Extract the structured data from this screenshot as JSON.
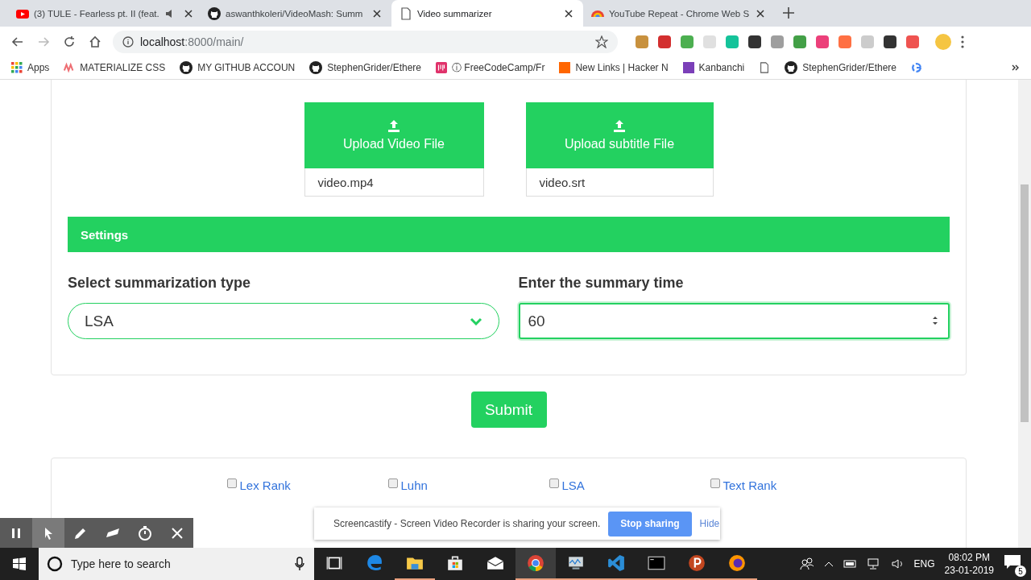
{
  "browser": {
    "tabs": [
      {
        "kind": "youtube",
        "title": "(3) TULE - Fearless pt. II (feat.",
        "muted_icon": true,
        "selected": false
      },
      {
        "kind": "github",
        "title": "aswanthkoleri/VideoMash: Summ",
        "muted_icon": false,
        "selected": false
      },
      {
        "kind": "page",
        "title": "Video summarizer",
        "muted_icon": false,
        "selected": true
      },
      {
        "kind": "store",
        "title": "YouTube Repeat - Chrome Web S",
        "muted_icon": false,
        "selected": false
      }
    ],
    "address": {
      "host": "localhost",
      "rest": ":8000/main/"
    },
    "bookmarks": [
      {
        "kind": "apps",
        "label": "Apps"
      },
      {
        "kind": "materialize",
        "label": "MATERIALIZE CSS"
      },
      {
        "kind": "github",
        "label": "MY GITHUB ACCOUN"
      },
      {
        "kind": "github",
        "label": "StephenGrider/Ethere"
      },
      {
        "kind": "fcc",
        "label": "ⓘ FreeCodeCamp/Fr"
      },
      {
        "kind": "hacker",
        "label": "New Links | Hacker N"
      },
      {
        "kind": "kanban",
        "label": "Kanbanchi"
      },
      {
        "kind": "file"
      },
      {
        "kind": "github",
        "label": "StephenGrider/Ethere"
      },
      {
        "kind": "google"
      }
    ]
  },
  "page": {
    "uploads": [
      {
        "label": "Upload Video File",
        "filename": "video.mp4"
      },
      {
        "label": "Upload subtitle File",
        "filename": "video.srt"
      }
    ],
    "settings": {
      "title": "Settings",
      "type_label": "Select summarization type",
      "type_value": "LSA",
      "time_label": "Enter the summary time",
      "time_value": "60"
    },
    "submit": "Submit",
    "methods": [
      {
        "label": "Lex Rank",
        "checked": false
      },
      {
        "label": "Luhn",
        "checked": false
      },
      {
        "label": "LSA",
        "checked": false
      },
      {
        "label": "Text Rank",
        "checked": false
      }
    ]
  },
  "recorder_toolbar": {
    "tools": [
      {
        "kind": "pause",
        "selected": false
      },
      {
        "kind": "pointer",
        "selected": true
      },
      {
        "kind": "pen",
        "selected": false
      },
      {
        "kind": "eraser",
        "selected": false
      },
      {
        "kind": "timer",
        "selected": false
      },
      {
        "kind": "close",
        "selected": false
      }
    ]
  },
  "sharing_bar": {
    "message": "Screencastify - Screen Video Recorder is sharing your screen.",
    "stop_button": "Stop sharing",
    "hide_link": "Hide"
  },
  "taskbar": {
    "search_placeholder": "Type here to search",
    "apps": [
      {
        "kind": "task-view",
        "selected": false
      },
      {
        "kind": "edge",
        "selected": false
      },
      {
        "kind": "folder",
        "selected": false
      },
      {
        "kind": "store",
        "selected": false
      },
      {
        "kind": "mail",
        "selected": false
      },
      {
        "kind": "chrome",
        "selected": true
      },
      {
        "kind": "monitor",
        "selected": false
      },
      {
        "kind": "vscode",
        "selected": false
      },
      {
        "kind": "terminal",
        "selected": false
      },
      {
        "kind": "psiphon",
        "selected": false
      },
      {
        "kind": "firefox",
        "selected": false
      }
    ],
    "language": "ENG",
    "time": "08:02 PM",
    "date": "23-01-2019",
    "notifications": "5"
  }
}
